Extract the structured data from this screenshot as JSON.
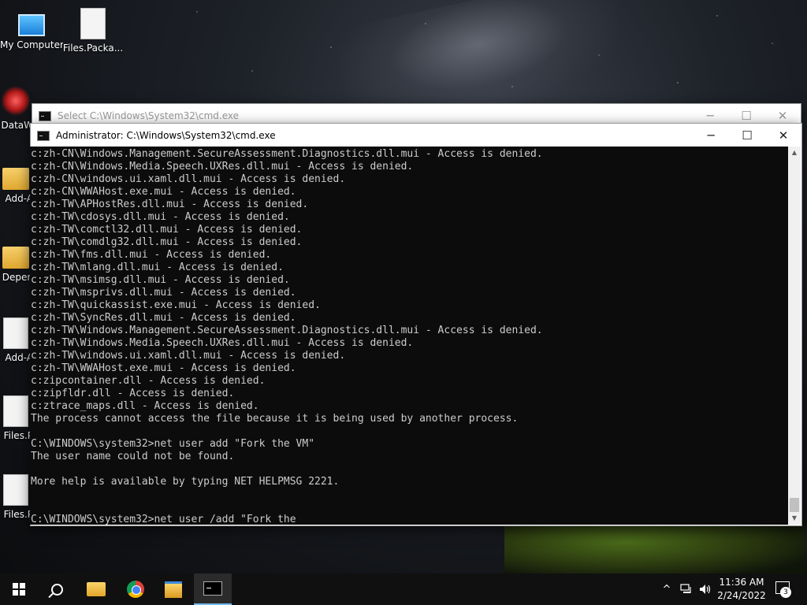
{
  "desktop": {
    "icons": [
      {
        "label": "My Computer",
        "icon": "computer-icon"
      },
      {
        "label": "Files.Packa...",
        "icon": "file-icon"
      },
      {
        "label": "DataW",
        "icon": "app-icon"
      },
      {
        "label": "Add-A",
        "icon": "folder-icon"
      },
      {
        "label": "Depen",
        "icon": "folder-icon"
      },
      {
        "label": "Add-A",
        "icon": "shortcut-icon"
      },
      {
        "label": "Files.P",
        "icon": "file-icon"
      },
      {
        "label": "Files.P",
        "icon": "file-icon"
      }
    ]
  },
  "back_window": {
    "title": "Select C:\\Windows\\System32\\cmd.exe",
    "icon": "cmd-icon"
  },
  "cmd_window": {
    "title": "Administrator: C:\\Windows\\System32\\cmd.exe",
    "icon": "cmd-icon",
    "controls": {
      "minimize": "─",
      "maximize": "☐",
      "close": "✕"
    },
    "lines": [
      "c:zh-CN\\Windows.Management.SecureAssessment.Diagnostics.dll.mui - Access is denied.",
      "c:zh-CN\\Windows.Media.Speech.UXRes.dll.mui - Access is denied.",
      "c:zh-CN\\windows.ui.xaml.dll.mui - Access is denied.",
      "c:zh-CN\\WWAHost.exe.mui - Access is denied.",
      "c:zh-TW\\APHostRes.dll.mui - Access is denied.",
      "c:zh-TW\\cdosys.dll.mui - Access is denied.",
      "c:zh-TW\\comctl32.dll.mui - Access is denied.",
      "c:zh-TW\\comdlg32.dll.mui - Access is denied.",
      "c:zh-TW\\fms.dll.mui - Access is denied.",
      "c:zh-TW\\mlang.dll.mui - Access is denied.",
      "c:zh-TW\\msimsg.dll.mui - Access is denied.",
      "c:zh-TW\\msprivs.dll.mui - Access is denied.",
      "c:zh-TW\\quickassist.exe.mui - Access is denied.",
      "c:zh-TW\\SyncRes.dll.mui - Access is denied.",
      "c:zh-TW\\Windows.Management.SecureAssessment.Diagnostics.dll.mui - Access is denied.",
      "c:zh-TW\\Windows.Media.Speech.UXRes.dll.mui - Access is denied.",
      "c:zh-TW\\windows.ui.xaml.dll.mui - Access is denied.",
      "c:zh-TW\\WWAHost.exe.mui - Access is denied.",
      "c:zipcontainer.dll - Access is denied.",
      "c:zipfldr.dll - Access is denied.",
      "c:ztrace_maps.dll - Access is denied.",
      "The process cannot access the file because it is being used by another process.",
      "",
      "C:\\WINDOWS\\system32>net user add \"Fork the VM\"",
      "The user name could not be found.",
      "",
      "More help is available by typing NET HELPMSG 2221.",
      "",
      "",
      "C:\\WINDOWS\\system32>net user /add \"Fork the"
    ]
  },
  "taskbar": {
    "start": "windows-start-icon",
    "items": [
      "search-icon",
      "file-explorer-icon",
      "chrome-icon",
      "explorer-folder-icon",
      "cmd-icon"
    ],
    "tray": {
      "chevron": "^",
      "network": "network-icon",
      "volume": "volume-icon"
    },
    "time": "11:36 AM",
    "date": "2/24/2022",
    "notifications": "3"
  }
}
